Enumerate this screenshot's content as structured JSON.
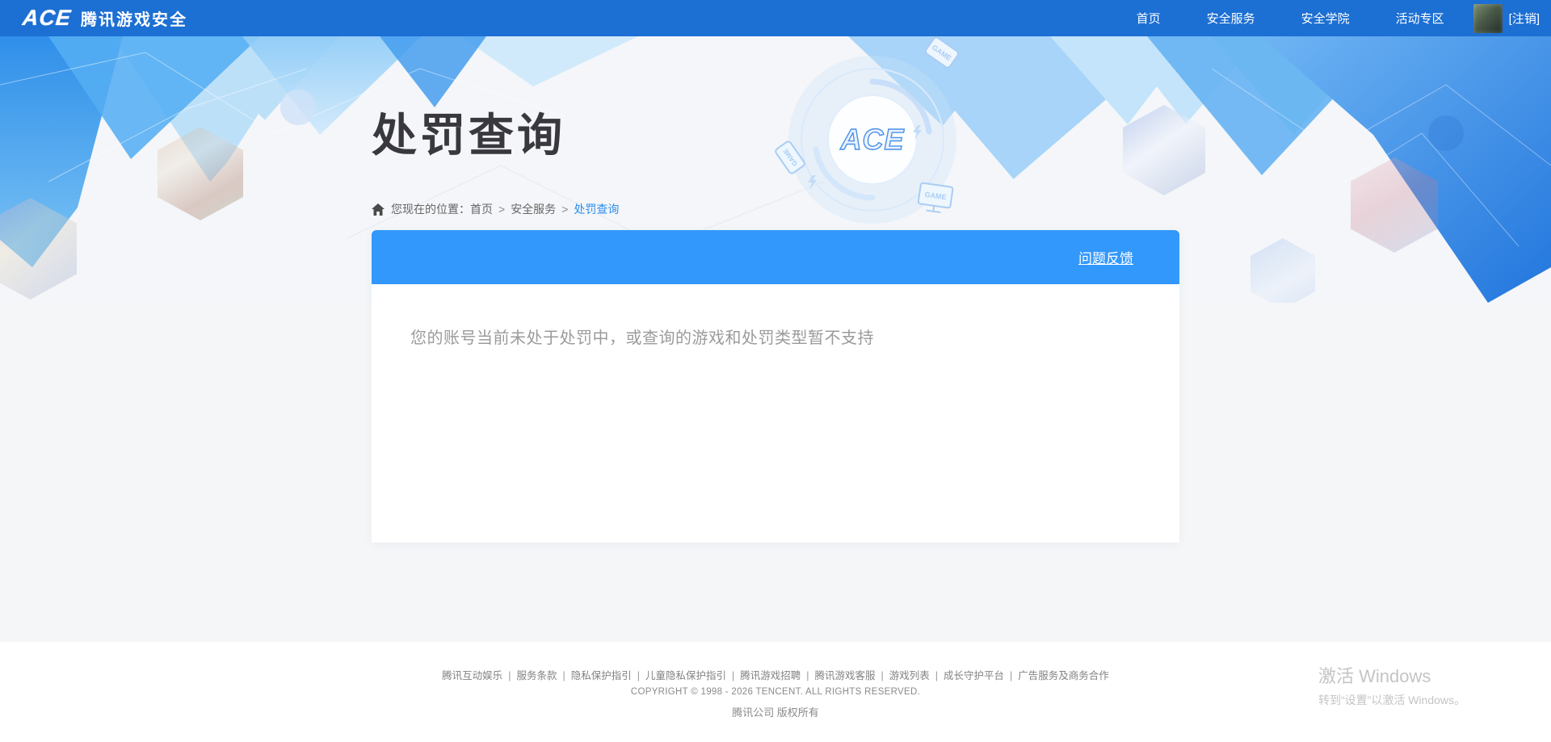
{
  "colors": {
    "header_blue": "#1c6fd3",
    "panel_blue": "#3398fc",
    "breadcrumb_active_blue": "#2e8ded",
    "title_dark": "#38383e",
    "message_gray": "#9b9b9b"
  },
  "header": {
    "brand": {
      "logo_text": "ACE",
      "title": "腾讯游戏安全"
    },
    "nav": [
      "首页",
      "安全服务",
      "安全学院",
      "活动专区"
    ],
    "logout_label": "[注销]"
  },
  "banner": {
    "title": "处罚查询",
    "breadcrumb": {
      "prefix": "您现在的位置：",
      "home": "首页",
      "separator": ">",
      "section": "安全服务",
      "current": "处罚查询"
    },
    "emblem_text": "ACE",
    "game_label": "GAME"
  },
  "panel": {
    "feedback_label": "问题反馈",
    "message": "您的账号当前未处于处罚中，或查询的游戏和处罚类型暂不支持"
  },
  "footer": {
    "links": [
      "腾讯互动娱乐",
      "服务条款",
      "隐私保护指引",
      "儿童隐私保护指引",
      "腾讯游戏招聘",
      "腾讯游戏客服",
      "游戏列表",
      "成长守护平台",
      "广告服务及商务合作"
    ],
    "separator": "|",
    "copyright": "COPYRIGHT © 1998 - 2026 TENCENT. ALL RIGHTS RESERVED.",
    "company": "腾讯公司 版权所有"
  },
  "watermark": {
    "line1": "激活 Windows",
    "line2": "转到“设置”以激活 Windows。"
  }
}
